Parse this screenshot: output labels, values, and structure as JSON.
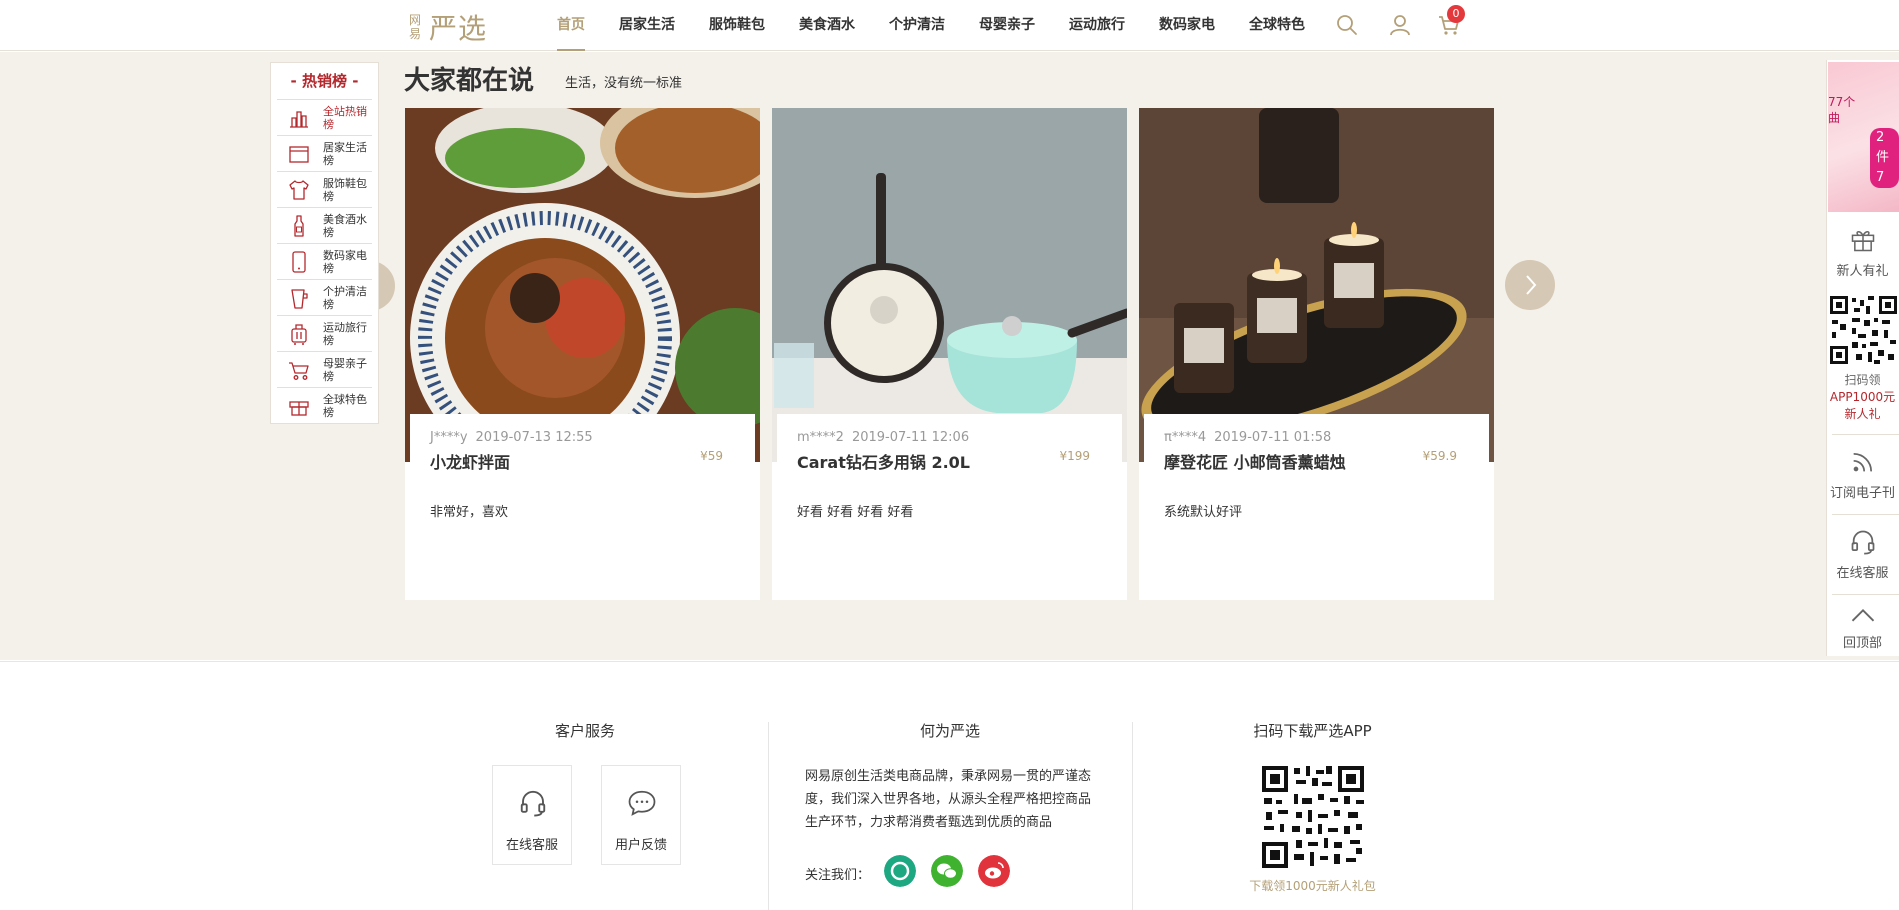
{
  "header": {
    "logo_small": "网易",
    "logo_big": "严选",
    "nav": [
      "首页",
      "居家生活",
      "服饰鞋包",
      "美食酒水",
      "个护清洁",
      "母婴亲子",
      "运动旅行",
      "数码家电",
      "全球特色"
    ],
    "cart_count": "0"
  },
  "section": {
    "title": "大家都在说",
    "subtitle": "生活，没有统一标准"
  },
  "ranking": {
    "title": "- 热销榜 -",
    "items": [
      {
        "label": "全站热销榜",
        "icon": "chart-icon"
      },
      {
        "label": "居家生活榜",
        "icon": "home-icon"
      },
      {
        "label": "服饰鞋包榜",
        "icon": "shirt-icon"
      },
      {
        "label": "美食酒水榜",
        "icon": "bottle-icon"
      },
      {
        "label": "数码家电榜",
        "icon": "phone-icon"
      },
      {
        "label": "个护清洁榜",
        "icon": "cup-icon"
      },
      {
        "label": "运动旅行榜",
        "icon": "luggage-icon"
      },
      {
        "label": "母婴亲子榜",
        "icon": "stroller-icon"
      },
      {
        "label": "全球特色榜",
        "icon": "gift-icon"
      }
    ]
  },
  "cards": [
    {
      "user": "J****y",
      "time": "2019-07-13 12:55",
      "title": "小龙虾拌面",
      "price": "¥59",
      "comment": "非常好，喜欢"
    },
    {
      "user": "m****2",
      "time": "2019-07-11 12:06",
      "title": "Carat钻石多用锅 2.0L",
      "price": "¥199",
      "comment": "好看 好看 好看 好看"
    },
    {
      "user": "π****4",
      "time": "2019-07-11 01:58",
      "title": "摩登花匠 小邮筒香薰蜡烛",
      "price": "¥59.9",
      "comment": "系统默认好评"
    }
  ],
  "float": {
    "promo_line1": "77个",
    "promo_line2": "曲",
    "promo_badge": "2件7",
    "gift": "新人有礼",
    "qr_line1": "扫码领",
    "qr_line2": "APP1000元",
    "qr_line3": "新人礼",
    "subscribe": "订阅电子刊",
    "service": "在线客服",
    "top": "回顶部"
  },
  "footer": {
    "col1_title": "客户服务",
    "online_service": "在线客服",
    "feedback": "用户反馈",
    "col2_title": "何为严选",
    "about": "网易原创生活类电商品牌，秉承网易一贯的严谨态度，我们深入世界各地，从源头全程严格把控商品生产环节，力求帮消费者甄选到优质的商品",
    "follow": "关注我们：",
    "col3_title": "扫码下载严选APP",
    "qr_caption": "下载领1000元新人礼包"
  },
  "colors": {
    "accent": "#b4a078",
    "brand_red": "#b4282d",
    "background": "#f4f0ea"
  }
}
